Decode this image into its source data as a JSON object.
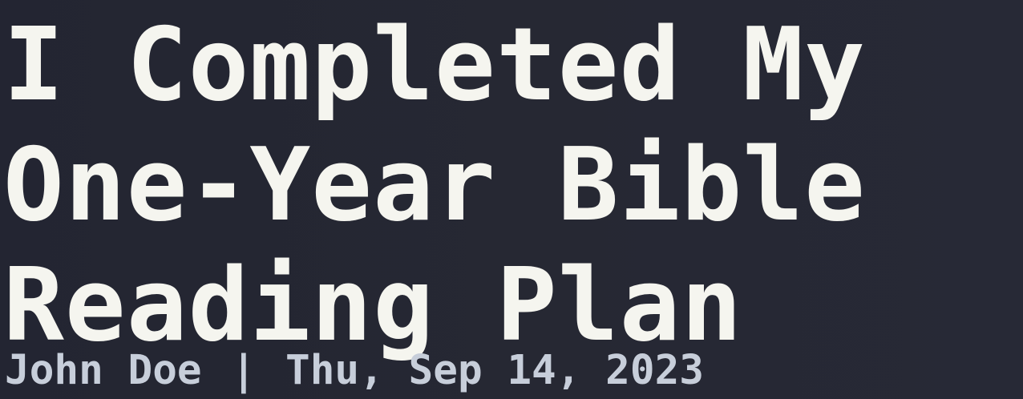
{
  "post": {
    "title_lines": [
      "I Completed My",
      "One-Year Bible",
      "Reading Plan"
    ],
    "author": "John Doe",
    "separator": "|",
    "date": "Thu, Sep 14, 2023"
  },
  "colors": {
    "background": "#232532",
    "title": "#f5f5ef",
    "meta": "#c7ceda"
  }
}
